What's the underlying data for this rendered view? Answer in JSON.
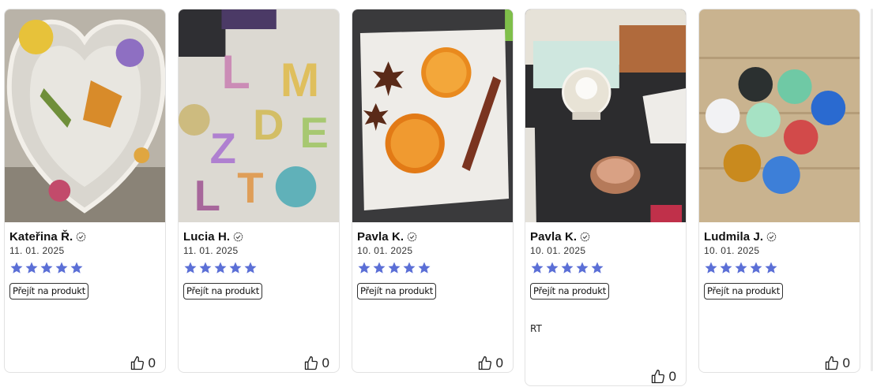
{
  "star_color": "#5b6fd6",
  "reviews": [
    {
      "name": "Kateřina Ř.",
      "date": "11. 01. 2025",
      "rating": 5,
      "button": "Přejít na produkt",
      "comment": "",
      "likes": "0"
    },
    {
      "name": "Lucia H.",
      "date": "11. 01. 2025",
      "rating": 5,
      "button": "Přejít na produkt",
      "comment": "",
      "likes": "0"
    },
    {
      "name": "Pavla K.",
      "date": "10. 01. 2025",
      "rating": 5,
      "button": "Přejít na produkt",
      "comment": "",
      "likes": "0"
    },
    {
      "name": "Pavla K.",
      "date": "10. 01. 2025",
      "rating": 5,
      "button": "Přejít na produkt",
      "comment": "RT",
      "likes": "0"
    },
    {
      "name": "Ludmila J.",
      "date": "10. 01. 2025",
      "rating": 5,
      "button": "Přejít na produkt",
      "comment": "",
      "likes": "0"
    }
  ]
}
